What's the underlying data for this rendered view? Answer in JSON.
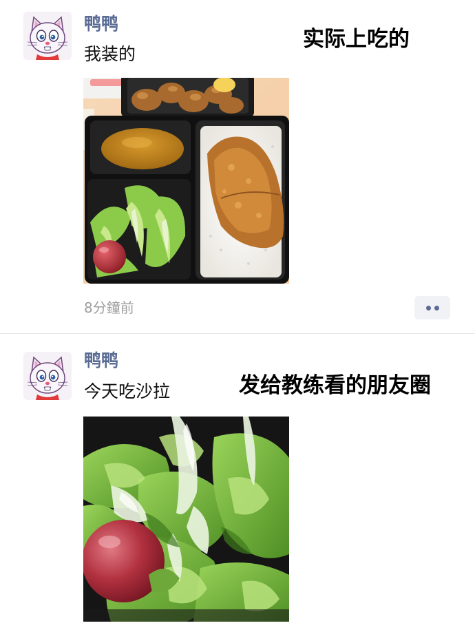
{
  "posts": [
    {
      "username": "鸭鸭",
      "caption": "我装的",
      "overlay_label": "实际上吃的",
      "photo_subject": "bento-box-with-cutlet-curry-rice-and-salad",
      "timestamp": "8分鐘前",
      "more_icon": "more-dots-icon"
    },
    {
      "username": "鸭鸭",
      "caption": "今天吃沙拉",
      "overlay_label": "发给教练看的朋友圈",
      "photo_subject": "close-up-salad-with-lettuce-and-tomato"
    }
  ],
  "colors": {
    "username": "#5a6b94",
    "timestamp": "#9e9e9e",
    "divider": "#e6e6e6",
    "more_button_bg": "#f1f2f5"
  }
}
